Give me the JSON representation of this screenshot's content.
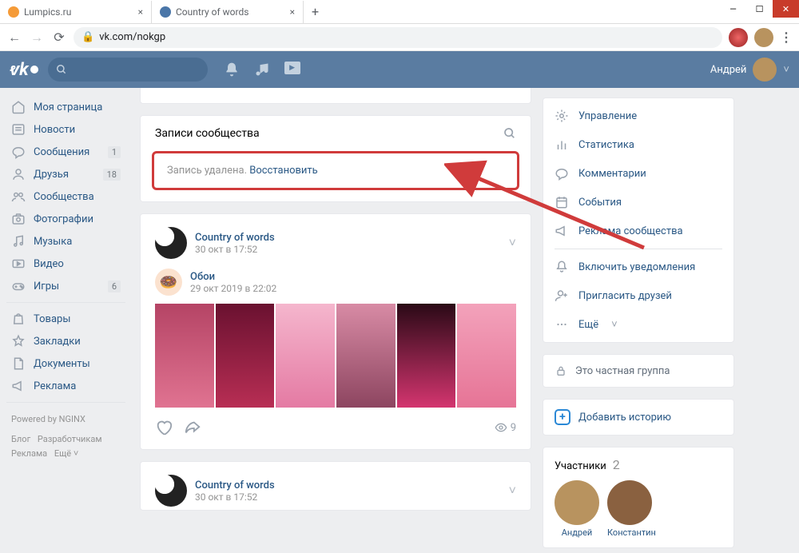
{
  "browser": {
    "tabs": [
      {
        "label": "Lumpics.ru",
        "icon_color": "#f59b38"
      },
      {
        "label": "Country of words",
        "icon_color": "#4a76a8"
      }
    ],
    "url": "vk.com/nokgp"
  },
  "vk_header": {
    "user_name": "Андрей"
  },
  "sidebar": {
    "items": [
      {
        "label": "Моя страница",
        "badge": ""
      },
      {
        "label": "Новости",
        "badge": ""
      },
      {
        "label": "Сообщения",
        "badge": "1"
      },
      {
        "label": "Друзья",
        "badge": "18"
      },
      {
        "label": "Сообщества",
        "badge": ""
      },
      {
        "label": "Фотографии",
        "badge": ""
      },
      {
        "label": "Музыка",
        "badge": ""
      },
      {
        "label": "Видео",
        "badge": ""
      },
      {
        "label": "Игры",
        "badge": "6"
      }
    ],
    "items2": [
      {
        "label": "Товары"
      },
      {
        "label": "Закладки"
      },
      {
        "label": "Документы"
      },
      {
        "label": "Реклама"
      }
    ],
    "powered": "Powered by NGINX",
    "footer_links": [
      "Блог",
      "Разработчикам",
      "Реклама",
      "Ещё ˅"
    ]
  },
  "feed": {
    "wall_title": "Записи сообщества",
    "deleted_text": "Запись удалена. ",
    "restore_link": "Восстановить",
    "post1": {
      "author": "Country of words",
      "date": "30 окт в 17:52",
      "repost_title": "Обои",
      "repost_date": "29 окт 2019 в 22:02",
      "views": "9"
    },
    "post2": {
      "author": "Country of words",
      "date": "30 окт в 17:52"
    }
  },
  "right": {
    "menu": [
      {
        "label": "Управление"
      },
      {
        "label": "Статистика"
      },
      {
        "label": "Комментарии"
      },
      {
        "label": "События"
      },
      {
        "label": "Реклама сообщества"
      }
    ],
    "menu2": [
      {
        "label": "Включить уведомления"
      },
      {
        "label": "Пригласить друзей"
      },
      {
        "label": "Ещё"
      }
    ],
    "private_text": "Это частная группа",
    "story_text": "Добавить историю",
    "members_title": "Участники",
    "members_count": "2",
    "member_names": [
      "Андрей",
      "Константин"
    ]
  }
}
